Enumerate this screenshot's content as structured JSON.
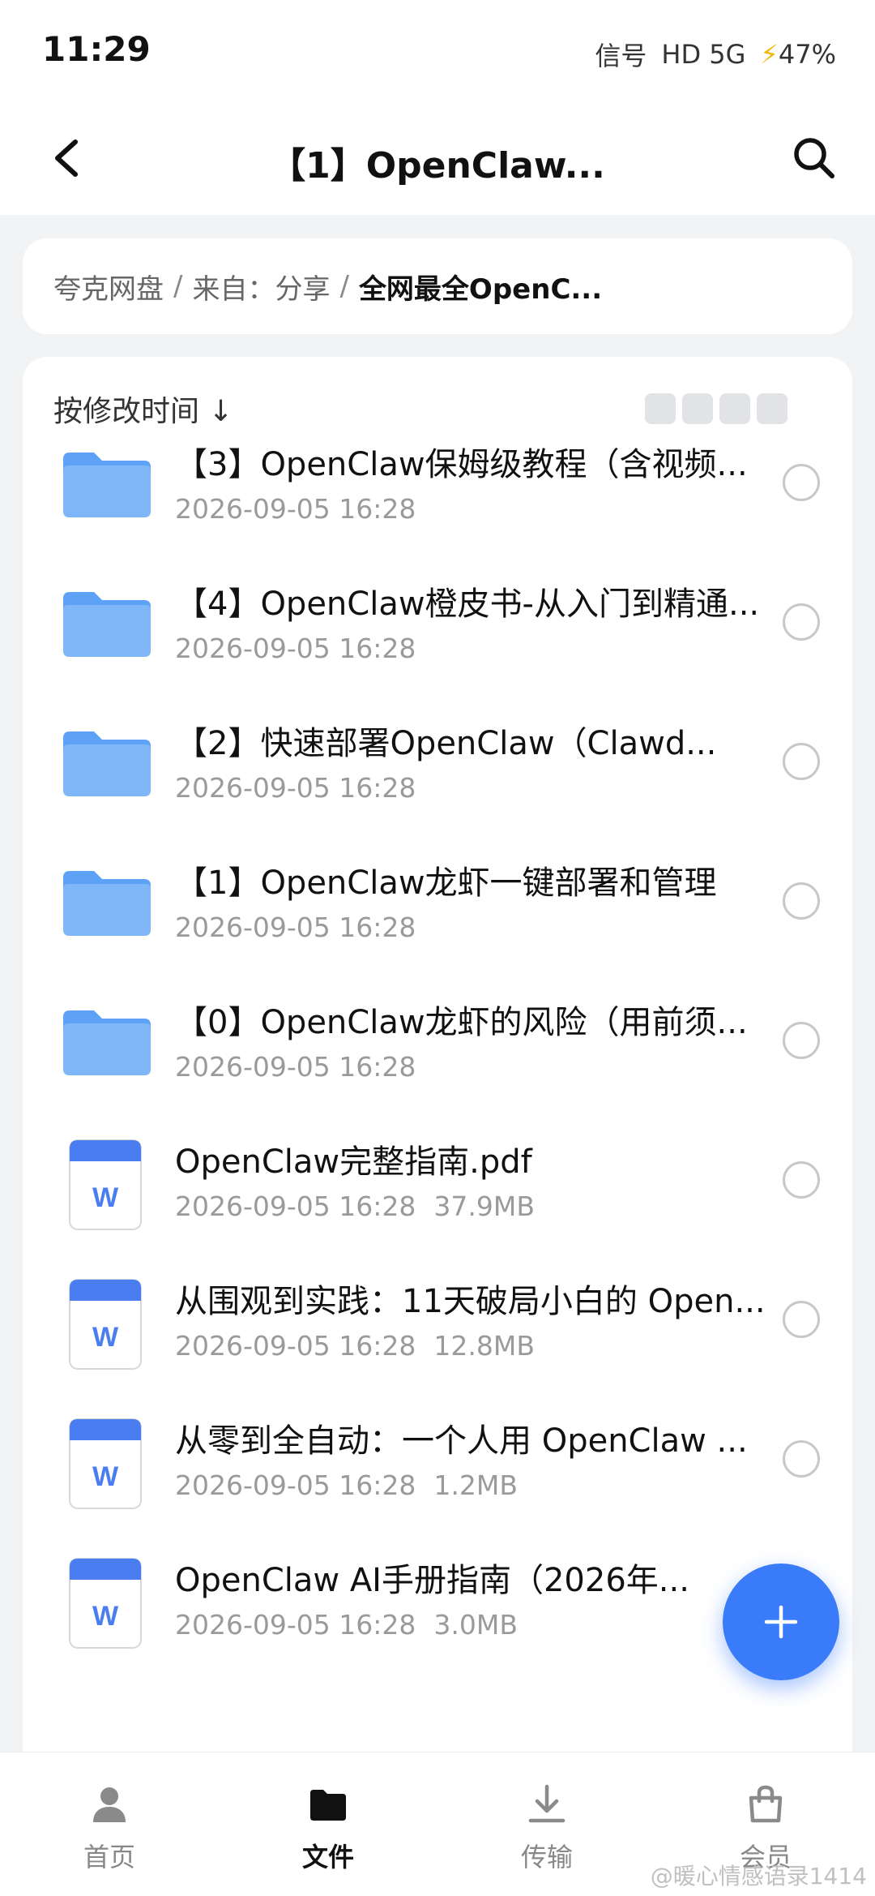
{
  "status": {
    "time": "11:29",
    "signal": "信号",
    "network": "HD 5G",
    "battery": "47%"
  },
  "appbar": {
    "title": "【1】OpenClaw..."
  },
  "breadcrumb": {
    "root": "夸克网盘",
    "from": "来自：分享",
    "current": "全网最全OpenC...",
    "separator": "/"
  },
  "sort": {
    "label": "按修改时间 ↓"
  },
  "items": [
    {
      "type": "folder",
      "name": "【3】OpenClaw保姆级教程（含视频...",
      "date": "2026-09-05 16:28",
      "size": ""
    },
    {
      "type": "folder",
      "name": "【4】OpenClaw橙皮书-从入门到精通...",
      "date": "2026-09-05 16:28",
      "size": ""
    },
    {
      "type": "folder",
      "name": "【2】快速部署OpenClaw（Clawd...",
      "date": "2026-09-05 16:28",
      "size": ""
    },
    {
      "type": "folder",
      "name": "【1】OpenClaw龙虾一键部署和管理",
      "date": "2026-09-05 16:28",
      "size": ""
    },
    {
      "type": "folder",
      "name": "【0】OpenClaw龙虾的风险（用前须...",
      "date": "2026-09-05 16:28",
      "size": ""
    },
    {
      "type": "doc",
      "name": "OpenClaw完整指南.pdf",
      "date": "2026-09-05 16:28",
      "size": "37.9MB"
    },
    {
      "type": "doc",
      "name": "从围观到实践：11天破局小白的 Open...",
      "date": "2026-09-05 16:28",
      "size": "12.8MB"
    },
    {
      "type": "doc",
      "name": "从零到全自动：一个人用 OpenClaw ...",
      "date": "2026-09-05 16:28",
      "size": "1.2MB"
    },
    {
      "type": "doc",
      "name": "OpenClaw AI手册指南（2026年...",
      "date": "2026-09-05 16:28",
      "size": "3.0MB"
    }
  ],
  "doc_icon_letter": "W",
  "nav": [
    {
      "label": "首页",
      "icon": "person-icon"
    },
    {
      "label": "文件",
      "icon": "folder-icon"
    },
    {
      "label": "传输",
      "icon": "download-icon"
    },
    {
      "label": "会员",
      "icon": "bag-icon"
    }
  ],
  "watermark": "@暖心情感语录1414",
  "colors": {
    "accent": "#3a7bfa",
    "folder": "#5ea2f5",
    "doc_header": "#4a7ef0"
  }
}
